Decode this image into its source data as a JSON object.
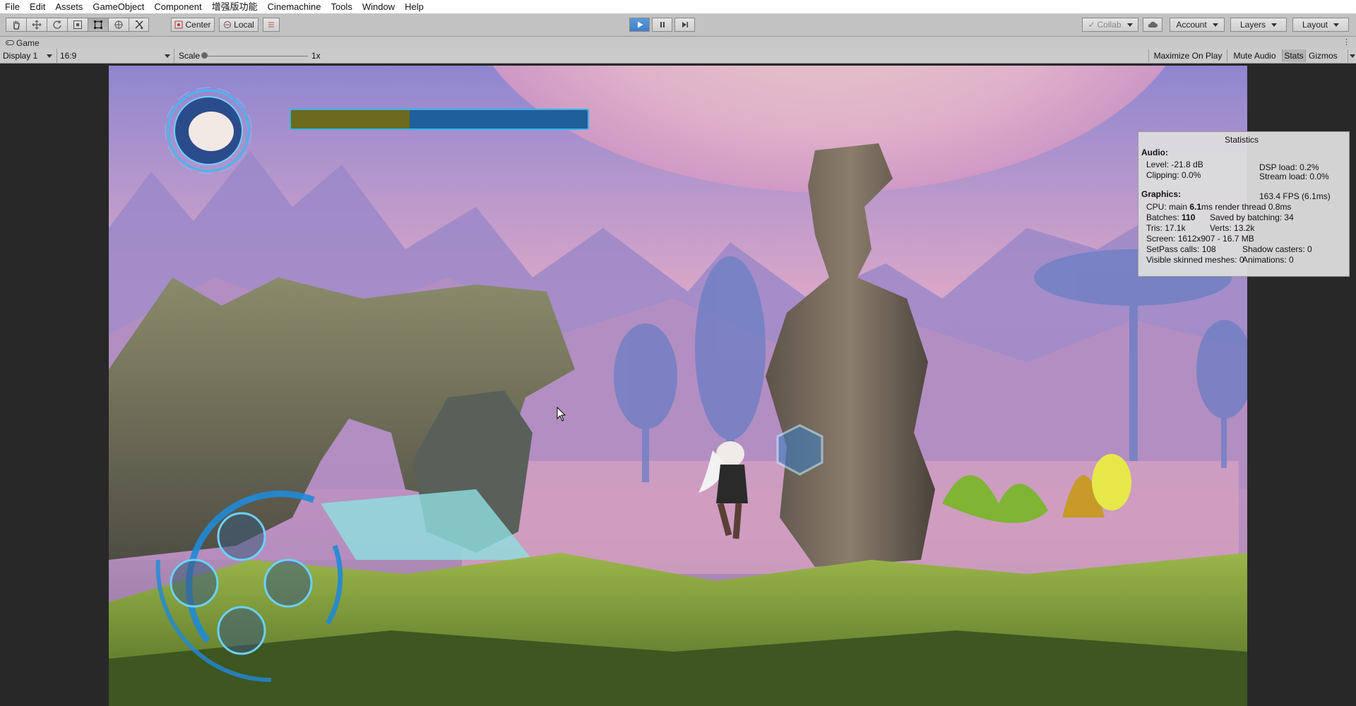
{
  "menu": [
    "File",
    "Edit",
    "Assets",
    "GameObject",
    "Component",
    "增强版功能",
    "Cinemachine",
    "Tools",
    "Window",
    "Help"
  ],
  "toolbar": {
    "tools": [
      "hand-tool",
      "move-tool",
      "rotate-tool",
      "scale-tool",
      "rect-tool",
      "transform-tool",
      "custom-tool"
    ],
    "pivot_label": "Center",
    "space_label": "Local",
    "collab_label": "Collab",
    "account_label": "Account",
    "layers_label": "Layers",
    "layout_label": "Layout",
    "accent": "#4a8bd0"
  },
  "game_tab": {
    "label": "Game"
  },
  "game_toolbar": {
    "display": "Display 1",
    "aspect": "16:9",
    "scale_label": "Scale",
    "scale_value": "1x",
    "maximize": "Maximize On Play",
    "mute": "Mute Audio",
    "stats": "Stats",
    "gizmos": "Gizmos"
  },
  "hud": {
    "health_fraction": 0.4,
    "health_color": "#6b6a1e",
    "bar_color": "#1f5f9a"
  },
  "stats": {
    "title": "Statistics",
    "audio_header": "Audio:",
    "level": "Level: -21.8 dB",
    "clipping": "Clipping: 0.0%",
    "dsp": "DSP load: 0.2%",
    "stream": "Stream load: 0.0%",
    "graphics_header": "Graphics:",
    "fps": "163.4 FPS (6.1ms)",
    "cpu_prefix": "CPU: main ",
    "cpu_main": "6.1",
    "cpu_suffix": "ms  render thread 0.8ms",
    "batches_prefix": "Batches: ",
    "batches_value": "110",
    "saved": "Saved by batching: 34",
    "tris": "Tris: 17.1k",
    "verts": "Verts: 13.2k",
    "screen": "Screen: 1612x907 - 16.7 MB",
    "setpass": "SetPass calls: 108",
    "shadow": "Shadow casters: 0",
    "skinned": "Visible skinned meshes: 0",
    "animations": "Animations: 0"
  }
}
